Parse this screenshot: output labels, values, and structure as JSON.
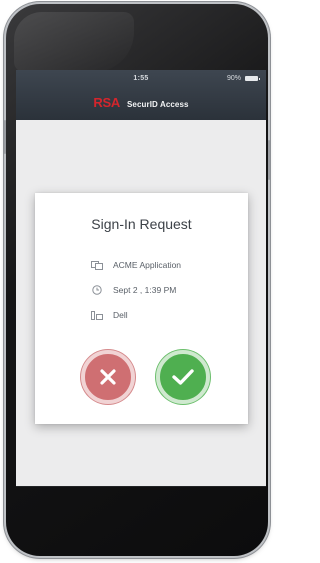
{
  "status_bar": {
    "time": "1:55",
    "battery_text": "90%"
  },
  "header": {
    "brand_logo": "RSA",
    "app_name": "SecurID Access",
    "brand_color": "#d4252c"
  },
  "request_card": {
    "title": "Sign-In Request",
    "details": [
      {
        "icon": "application-icon",
        "text": "ACME Application"
      },
      {
        "icon": "clock-icon",
        "text": "Sept 2 , 1:39 PM"
      },
      {
        "icon": "device-icon",
        "text": "Dell"
      }
    ],
    "deny_color": "#cf6f72",
    "approve_color": "#4faf50",
    "deny_icon": "close-icon",
    "approve_icon": "check-icon"
  }
}
